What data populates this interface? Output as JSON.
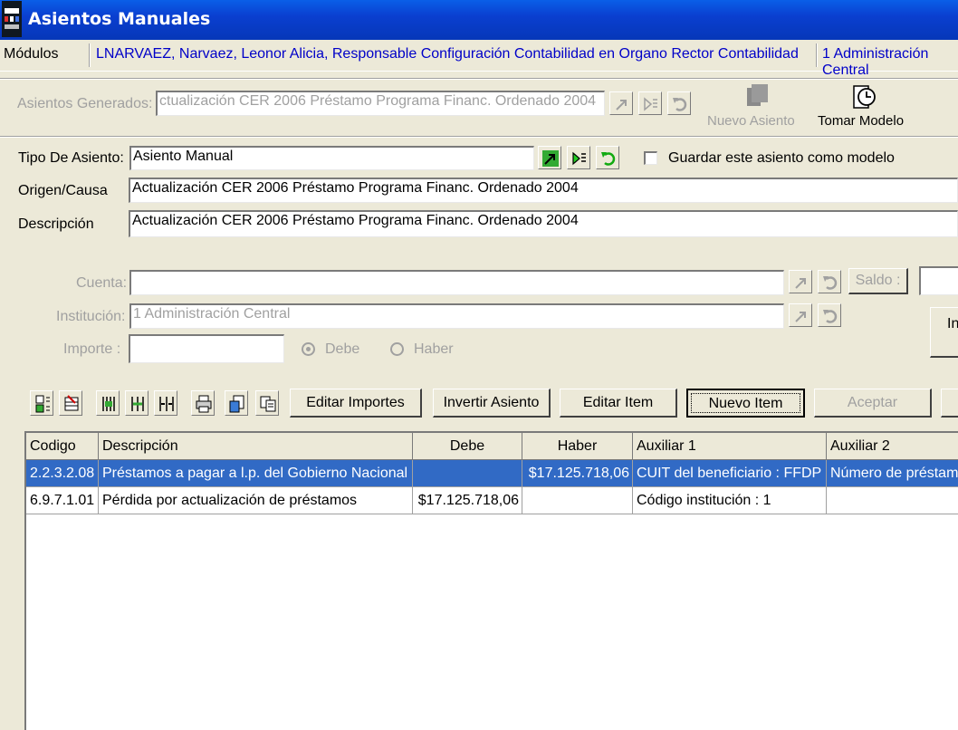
{
  "window": {
    "title": "Asientos Manuales"
  },
  "modules_bar": {
    "label": "Módulos",
    "user": "LNARVAEZ, Narvaez, Leonor Alicia, Responsable Configuración Contabilidad en Organo Rector Contabilidad",
    "institution": "1 Administración Central"
  },
  "generated": {
    "label": "Asientos Generados:",
    "value": "ctualización CER 2006 Préstamo Programa Financ. Ordenado 2004",
    "new_entry_label": "Nuevo Asiento",
    "take_model_label": "Tomar Modelo"
  },
  "form": {
    "tipo_label": "Tipo De Asiento:",
    "tipo_value": "Asiento Manual",
    "save_model_label": "Guardar este asiento como modelo",
    "origen_label": "Origen/Causa",
    "origen_value": "Actualización CER 2006 Préstamo Programa Financ. Ordenado 2004",
    "descripcion_label": "Descripción",
    "descripcion_value": "Actualización CER 2006 Préstamo Programa Financ. Ordenado 2004"
  },
  "detail": {
    "cuenta_label": "Cuenta:",
    "cuenta_value": "",
    "saldo_label": "Saldo :",
    "institucion_label": "Institución:",
    "institucion_value": "1 Administración Central",
    "importe_label": "Importe :",
    "importe_value": "",
    "debe_label": "Debe",
    "haber_label": "Haber",
    "side_button_label": "In"
  },
  "toolbar": {
    "editar_importes": "Editar Importes",
    "invertir_asiento": "Invertir Asiento",
    "editar_item": "Editar Item",
    "nuevo_item": "Nuevo Item",
    "aceptar": "Aceptar"
  },
  "grid": {
    "columns": [
      "Codigo",
      "Descripción",
      "Debe",
      "Haber",
      "Auxiliar 1",
      "Auxiliar 2"
    ],
    "rows": [
      {
        "codigo": "2.2.3.2.08",
        "descripcion": "Préstamos a pagar a l.p. del Gobierno Nacional",
        "debe": "",
        "haber": "$17.125.718,06",
        "aux1": "CUIT del beneficiario : FFDP",
        "aux2": "Número de préstam"
      },
      {
        "codigo": "6.9.7.1.01",
        "descripcion": "Pérdida por actualización de préstamos",
        "debe": "$17.125.718,06",
        "haber": "",
        "aux1": "Código institución  : 1",
        "aux2": ""
      }
    ]
  },
  "colors": {
    "titlebar": "#0a3fd0",
    "selection": "#316ac5",
    "modules_text": "#0000c8"
  }
}
